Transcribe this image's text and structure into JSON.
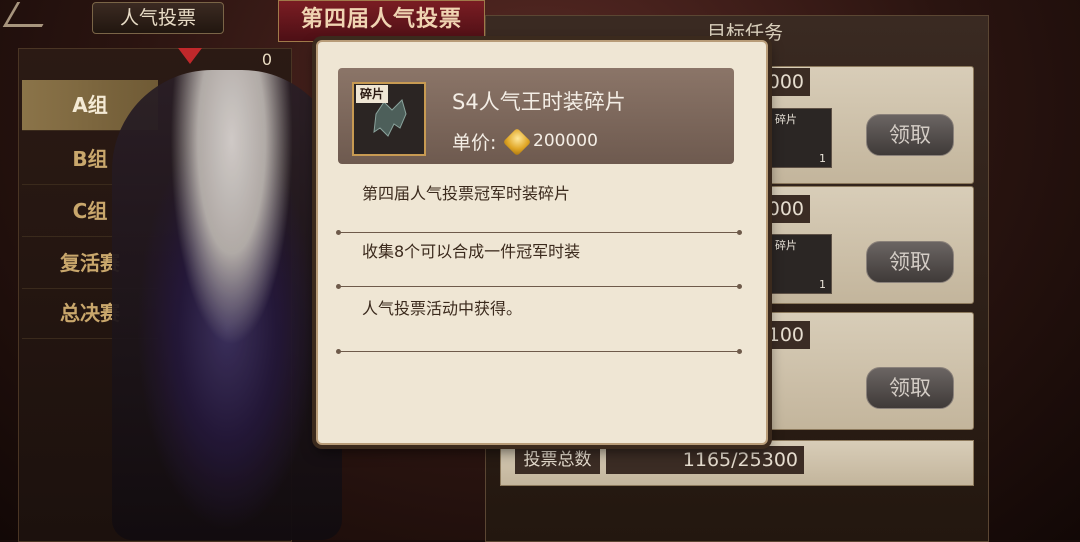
{
  "nav": {
    "title": "人气投票",
    "count": "0",
    "groups": [
      "A组",
      "B组",
      "C组",
      "复活赛",
      "总决赛"
    ],
    "active_group": "A组"
  },
  "event_banner": "第四届人气投票",
  "right_panel": {
    "title": "目标任务",
    "tasks": [
      {
        "target": "000",
        "reward_label": "碎片",
        "reward_qty": "1",
        "button": "领取"
      },
      {
        "target": "000",
        "reward_label": "碎片",
        "reward_qty": "1",
        "button": "领取"
      },
      {
        "target": "100",
        "button": "领取"
      }
    ],
    "votes_label": "投票总数",
    "votes_value": "1165/25300"
  },
  "popup": {
    "icon_tag": "碎片",
    "item_name": "S4人气王时装碎片",
    "price_label": "单价:",
    "price_value": "200000",
    "descriptions": [
      "第四届人气投票冠军时装碎片",
      "收集8个可以合成一件冠军时装",
      "人气投票活动中获得。"
    ]
  },
  "colors": {
    "popup_bg": "#efe6d4",
    "header_bg": "#7d685c",
    "accent_gold": "#c79a52",
    "banner_red": "#7a1d23"
  }
}
